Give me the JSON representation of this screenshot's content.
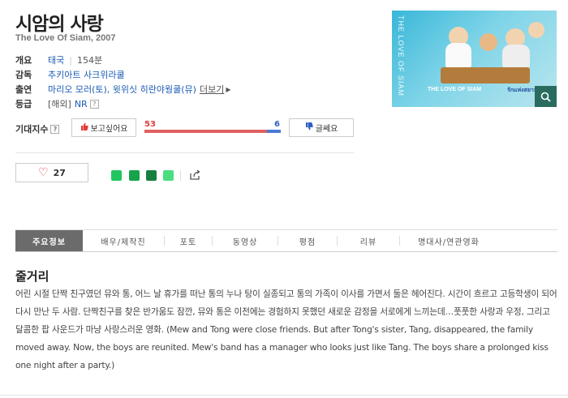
{
  "movie": {
    "title": "시암의 사랑",
    "subtitle": "The Love Of Siam, 2007"
  },
  "info": {
    "overview_label": "개요",
    "genre": "태국",
    "runtime": "154분",
    "director_label": "감독",
    "director": "추키아트 사크위라쿨",
    "cast_label": "출연",
    "cast": "마리오 모러(토), 윗위싯 히란야웡쿨(뮤)",
    "more_label": "더보기",
    "rating_label": "등급",
    "rating_region": "[해외]",
    "rating": "NR",
    "help_icon": "?"
  },
  "expectation": {
    "label": "기대지수",
    "want_label": "보고싶어요",
    "meh_label": "글쎄요",
    "want_count": "53",
    "meh_count": "6",
    "want_fraction": 0.8983
  },
  "like": {
    "count": "27"
  },
  "tabs": [
    {
      "label": "주요정보",
      "active": true
    },
    {
      "label": "배우/제작진",
      "active": false
    },
    {
      "label": "포토",
      "active": false
    },
    {
      "label": "동영상",
      "active": false
    },
    {
      "label": "평점",
      "active": false
    },
    {
      "label": "리뷰",
      "active": false
    },
    {
      "label": "명대사/연관영화",
      "active": false
    }
  ],
  "synopsis": {
    "heading": "줄거리",
    "text": "어린 시절 단짝 친구였던 뮤와 통, 어느 날 휴가를 떠난 통의 누나 탕이 실종되고 통의 가족이 이사를 가면서 둘은 헤어진다. 시간이 흐르고 고등학생이 되어 다시 만난 두 사람. 단짝친구를 찾은 반가움도 잠깐, 뮤와 통은 이전에는 경험하지 못했던 새로운 감정을 서로에게 느끼는데…풋풋한 사랑과 우정, 그리고 달콤한 팝 사운드가 마냥 사랑스러운 영화. (Mew and Tong were close friends. But after Tong's sister, Tang, disappeared, the family moved away. Now, the boys are reunited. Mew's band has a manager who looks just like Tang. The boys share a prolonged kiss one night after a party.)"
  },
  "poster": {
    "caption": "THE LOVE OF SIAM",
    "tag": "รักแห่งสยาม"
  },
  "colors": {
    "want": "#e33b3b",
    "meh": "#2f5fc4",
    "link": "#1a5bb5",
    "active_tab": "#6b6b6b"
  }
}
